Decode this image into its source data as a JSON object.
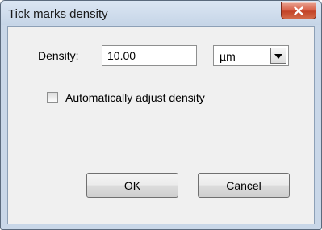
{
  "window": {
    "title": "Tick marks density",
    "close_glyph": "X"
  },
  "form": {
    "density_label": "Density:",
    "density_value": "10.00",
    "unit_selected": "µm",
    "auto_adjust_label": "Automatically adjust density",
    "auto_adjust_checked": false
  },
  "buttons": {
    "ok_label": "OK",
    "cancel_label": "Cancel"
  },
  "icons": {
    "close": "close-icon",
    "dropdown": "chevron-down-icon"
  },
  "colors": {
    "close_button": "#c94a2e",
    "frame": "#c9d7e8",
    "client_background": "#f0f0f0"
  }
}
